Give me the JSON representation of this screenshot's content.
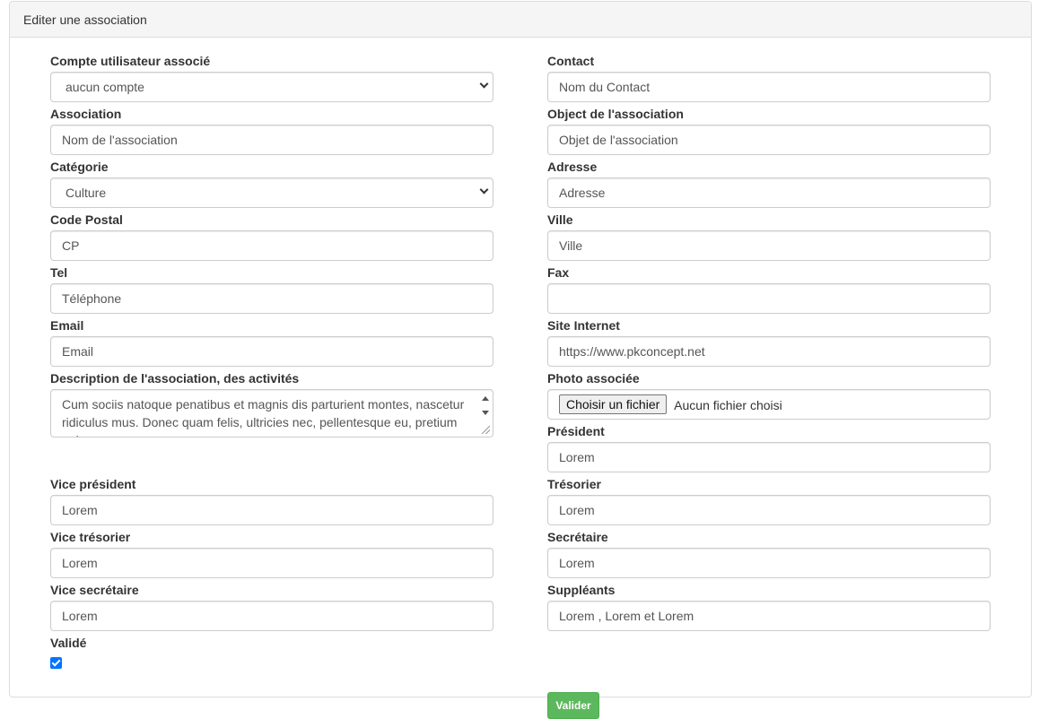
{
  "panel": {
    "title": "Editer une association"
  },
  "left": {
    "compte": {
      "label": "Compte utilisateur associé",
      "value": "aucun compte"
    },
    "association": {
      "label": "Association",
      "placeholder": "Nom de l'association"
    },
    "categorie": {
      "label": "Catégorie",
      "value": "Culture"
    },
    "code_postal": {
      "label": "Code Postal",
      "placeholder": "CP"
    },
    "tel": {
      "label": "Tel",
      "placeholder": "Téléphone"
    },
    "email": {
      "label": "Email",
      "placeholder": "Email"
    },
    "description": {
      "label": "Description de l'association, des activités",
      "value": "Cum sociis natoque penatibus et magnis dis parturient montes, nascetur ridiculus mus. Donec quam felis, ultricies nec, pellentesque eu, pretium quis"
    },
    "vice_president": {
      "label": "Vice président",
      "value": "Lorem"
    },
    "vice_tresorier": {
      "label": "Vice trésorier",
      "value": "Lorem"
    },
    "vice_secretaire": {
      "label": "Vice secrétaire",
      "value": "Lorem"
    },
    "valide": {
      "label": "Validé",
      "checked": true
    }
  },
  "right": {
    "contact": {
      "label": "Contact",
      "placeholder": "Nom du Contact"
    },
    "objet": {
      "label": "Object de l'association",
      "placeholder": "Objet de l'association"
    },
    "adresse": {
      "label": "Adresse",
      "placeholder": "Adresse"
    },
    "ville": {
      "label": "Ville",
      "placeholder": "Ville"
    },
    "fax": {
      "label": "Fax",
      "value": ""
    },
    "site": {
      "label": "Site Internet",
      "value": "https://www.pkconcept.net"
    },
    "photo": {
      "label": "Photo associée",
      "button": "Choisir un fichier",
      "status": "Aucun fichier choisi"
    },
    "president": {
      "label": "Président",
      "value": "Lorem"
    },
    "tresorier": {
      "label": "Trésorier",
      "value": "Lorem"
    },
    "secretaire": {
      "label": "Secrétaire",
      "value": "Lorem"
    },
    "suppleants": {
      "label": "Suppléants",
      "value": "Lorem , Lorem et Lorem"
    }
  },
  "actions": {
    "submit_label": "Valider",
    "submit_color": "#5cb85c"
  },
  "colors": {
    "checkbox": "#0075ff",
    "panel_heading_bg": "#f5f5f5",
    "border": "#cccccc"
  }
}
